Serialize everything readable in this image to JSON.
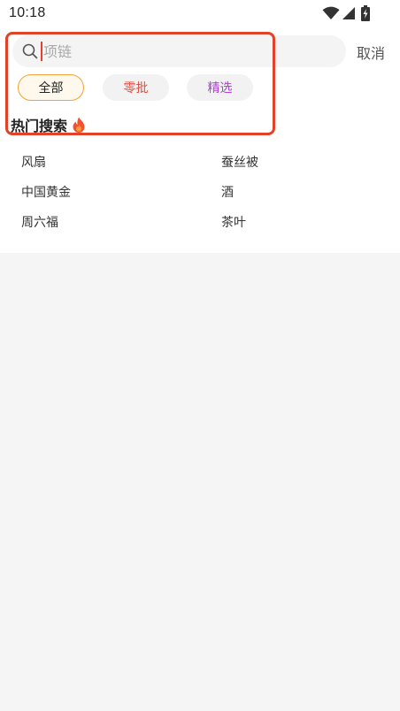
{
  "status_bar": {
    "time": "10:18",
    "icons": [
      "wifi-icon",
      "signal-icon",
      "battery-charging-icon"
    ]
  },
  "search": {
    "placeholder": "项链",
    "value": "",
    "cancel_label": "取消"
  },
  "filters": [
    {
      "label": "全部",
      "selected": true,
      "color": "#222222",
      "border_color": "#f2a23a"
    },
    {
      "label": "零批",
      "selected": false,
      "color": "#e84a3c"
    },
    {
      "label": "精选",
      "selected": false,
      "color": "#b23fd8"
    }
  ],
  "hot_search": {
    "title": "热门搜索",
    "icon": "fire-icon",
    "items": [
      "风扇",
      "蚕丝被",
      "中国黄金",
      "酒",
      "周六福",
      "茶叶"
    ]
  },
  "colors": {
    "accent": "#e84030",
    "highlight_box": "#e2412a",
    "page_background": "#f5f5f5"
  }
}
